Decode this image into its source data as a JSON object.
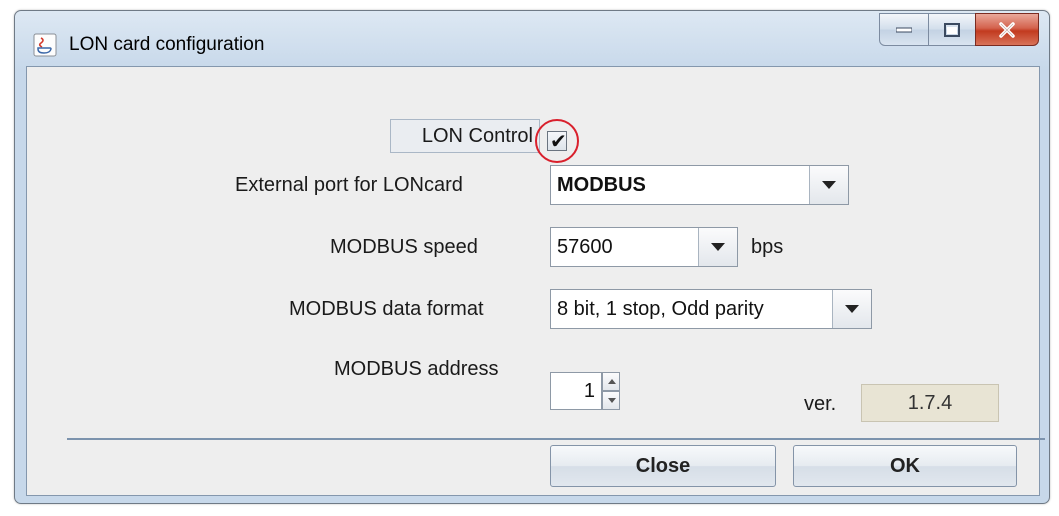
{
  "window": {
    "title": "LON card configuration"
  },
  "caption_buttons": [
    "minimize-icon",
    "maximize-icon",
    "close-icon"
  ],
  "form": {
    "lon_control": {
      "label": "LON Control",
      "checked": true
    },
    "external_port": {
      "label": "External port for LONcard",
      "value": "MODBUS"
    },
    "modbus_speed": {
      "label": "MODBUS speed",
      "value": "57600",
      "unit": "bps"
    },
    "modbus_data_format": {
      "label": "MODBUS data format",
      "value": "8 bit, 1 stop, Odd parity"
    },
    "modbus_address": {
      "label": "MODBUS address",
      "value": "1"
    },
    "version": {
      "label": "ver.",
      "value": "1.7.4"
    }
  },
  "buttons": {
    "close": "Close",
    "ok": "OK"
  },
  "colors": {
    "highlight_circle": "#d9202c",
    "version_field_bg": "#e8e4d4"
  }
}
